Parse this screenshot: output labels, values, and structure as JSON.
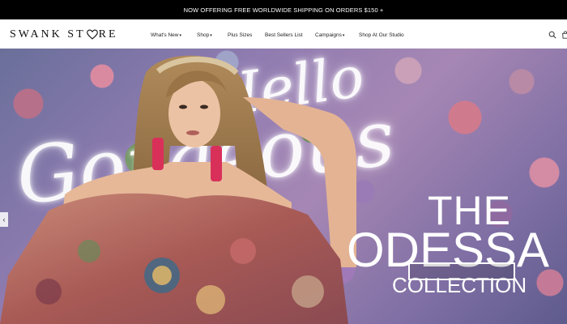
{
  "announcement": "NOW OFFERING FREE WORLDWIDE SHIPPING ON ORDERS $150 +",
  "logo": {
    "left": "SWANK ST",
    "right": "RE"
  },
  "nav": {
    "items": [
      {
        "label": "What's New",
        "dropdown": true
      },
      {
        "label": "Shop",
        "dropdown": true
      },
      {
        "label": "Plus Sizes",
        "dropdown": false
      },
      {
        "label": "Best Sellers List",
        "dropdown": false
      },
      {
        "label": "Campaigns",
        "dropdown": true
      },
      {
        "label": "Shop At Our Studio",
        "dropdown": false
      }
    ],
    "caret": "▾"
  },
  "icons": {
    "search": "search-icon",
    "cart": "cart-icon"
  },
  "hero": {
    "neon_line1": "Hello",
    "neon_line2": "Gorgeous",
    "title_the": "THE",
    "title_name": "ODESSA",
    "title_collection": "COLLECTION",
    "prev_arrow": "‹"
  },
  "colors": {
    "announce_bg": "#000000",
    "text": "#222222",
    "accent_white": "#ffffff"
  }
}
